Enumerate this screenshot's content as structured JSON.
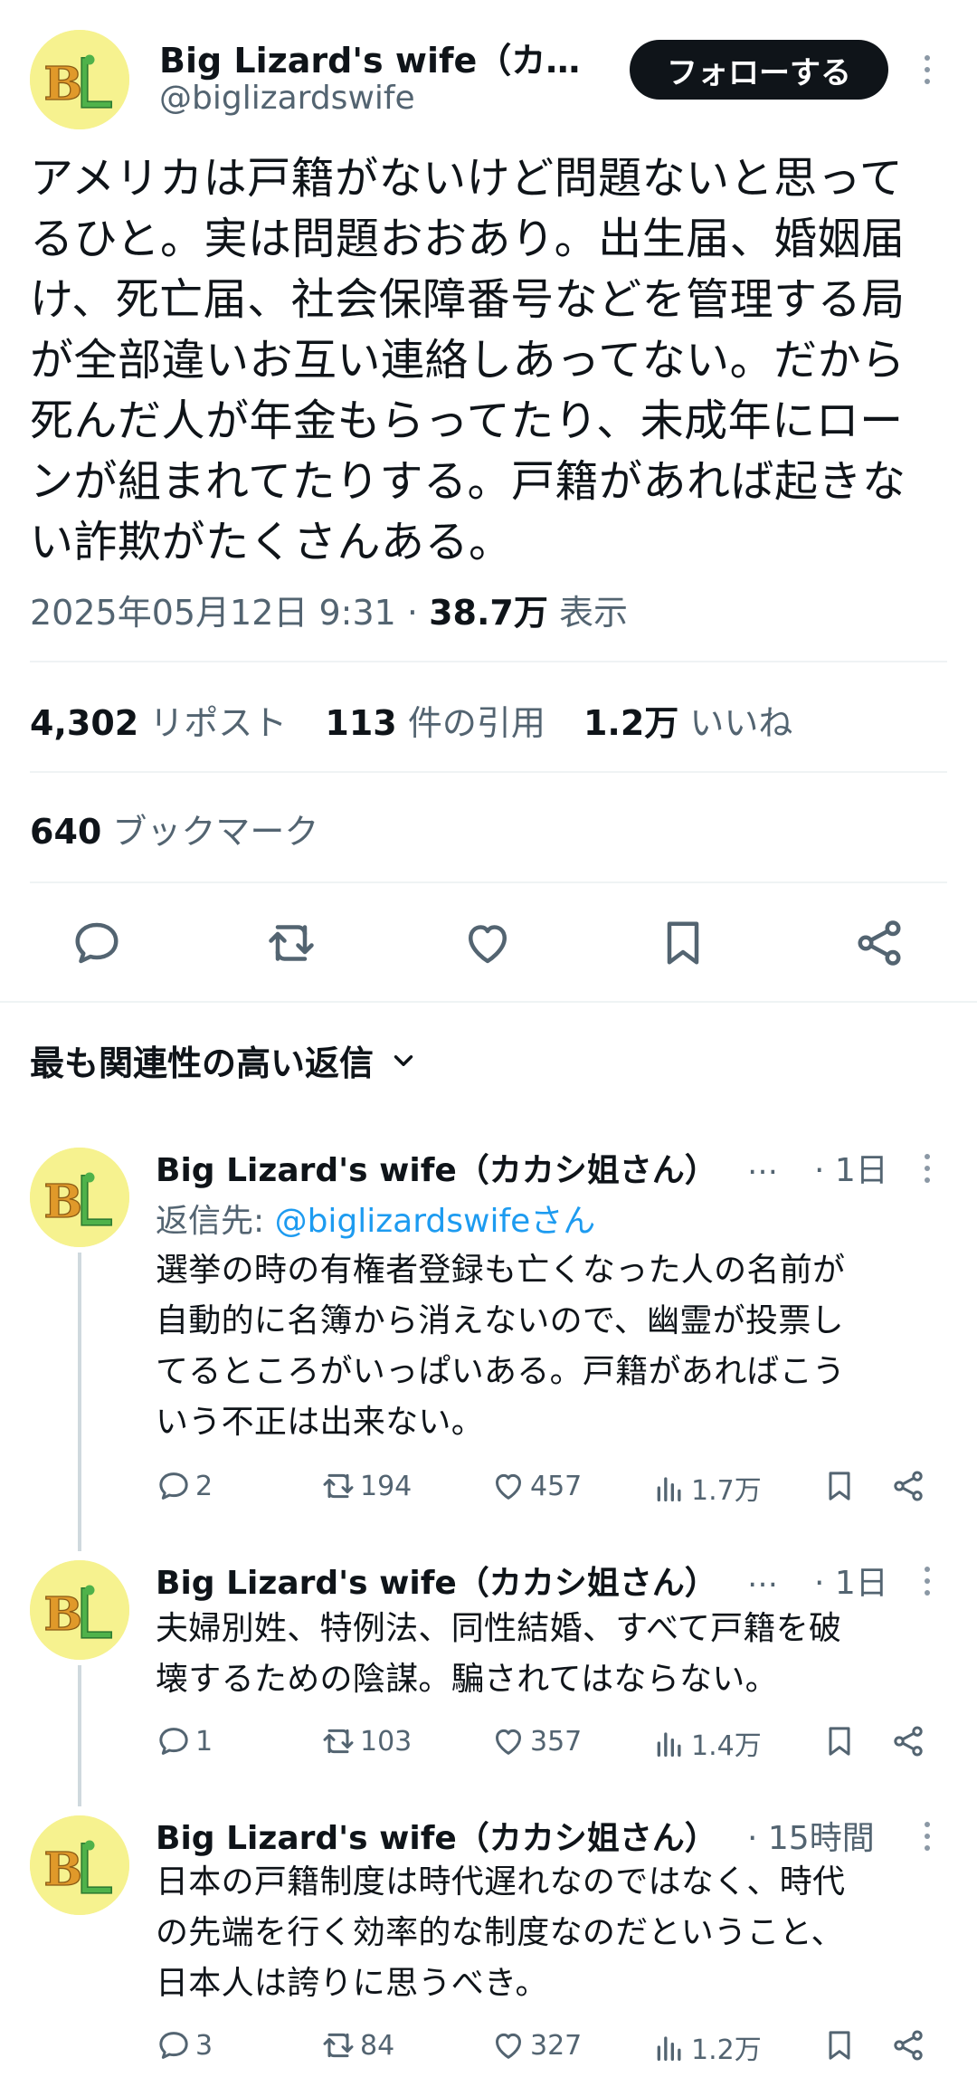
{
  "post": {
    "author_name": "Big Lizard's wife（カカ…",
    "author_handle": "@biglizardswife",
    "follow_label": "フォローする",
    "text_lines": [
      "アメリカは戸籍がないけど問題ないと思って",
      "るひと。実は問題おおあり。出生届、婚姻届",
      "け、死亡届、社会保障番号などを管理する局",
      "が全部違いお互い連絡しあってない。だから",
      "死んだ人が年金もらってたり、未成年にロー",
      "ンが組まれてたりする。戸籍があれば起きな",
      "い詐欺がたくさんある。"
    ],
    "timestamp": "2025年05月12日 9:31",
    "sep": "·",
    "views_value": "38.7万",
    "views_label": "表示",
    "reposts_value": "4,302",
    "reposts_label": "リポスト",
    "quotes_value": "113",
    "quotes_label": "件の引用",
    "likes_value": "1.2万",
    "likes_label": "いいね",
    "bookmarks_value": "640",
    "bookmarks_label": "ブックマーク",
    "avatar_text": "BL"
  },
  "sort": {
    "label": "最も関連性の高い返信"
  },
  "replies": [
    {
      "name": "Big Lizard's wife（カカシ姐さん）",
      "ellipsis": "…",
      "time": "· 1日",
      "reply_to_prefix": "返信先: ",
      "reply_to_mention": "@biglizardswifeさん",
      "text_lines": [
        "選挙の時の有権者登録も亡くなった人の名前が",
        "自動的に名簿から消えないので、幽霊が投票し",
        "てるところがいっぱいある。戸籍があればこう",
        "いう不正は出来ない。"
      ],
      "replies": "2",
      "reposts": "194",
      "likes": "457",
      "views": "1.7万"
    },
    {
      "name": "Big Lizard's wife（カカシ姐さん）",
      "ellipsis": "…",
      "time": "· 1日",
      "text_lines": [
        "夫婦別姓、特例法、同性結婚、すべて戸籍を破",
        "壊するための陰謀。騙されてはならない。"
      ],
      "replies": "1",
      "reposts": "103",
      "likes": "357",
      "views": "1.4万"
    },
    {
      "name": "Big Lizard's wife（カカシ姐さん）",
      "time": "· 15時間",
      "text_lines": [
        "日本の戸籍制度は時代遅れなのではなく、時代",
        "の先端を行く効率的な制度なのだということ、",
        "日本人は誇りに思うべき。"
      ],
      "replies": "3",
      "reposts": "84",
      "likes": "327",
      "views": "1.2万"
    }
  ],
  "colors": {
    "text": "#0f1419",
    "secondary": "#536471",
    "link": "#1d9bf0",
    "divider": "#eff3f4",
    "avatar_bg": "#f6f28f"
  },
  "icons": {
    "reply": "speech-bubble-icon",
    "repost": "repost-arrows-icon",
    "like": "heart-icon",
    "bookmark": "bookmark-icon",
    "share": "share-icon",
    "views": "bar-chart-icon",
    "sort": "chevron-down-icon",
    "more": "vertical-dots-icon"
  }
}
